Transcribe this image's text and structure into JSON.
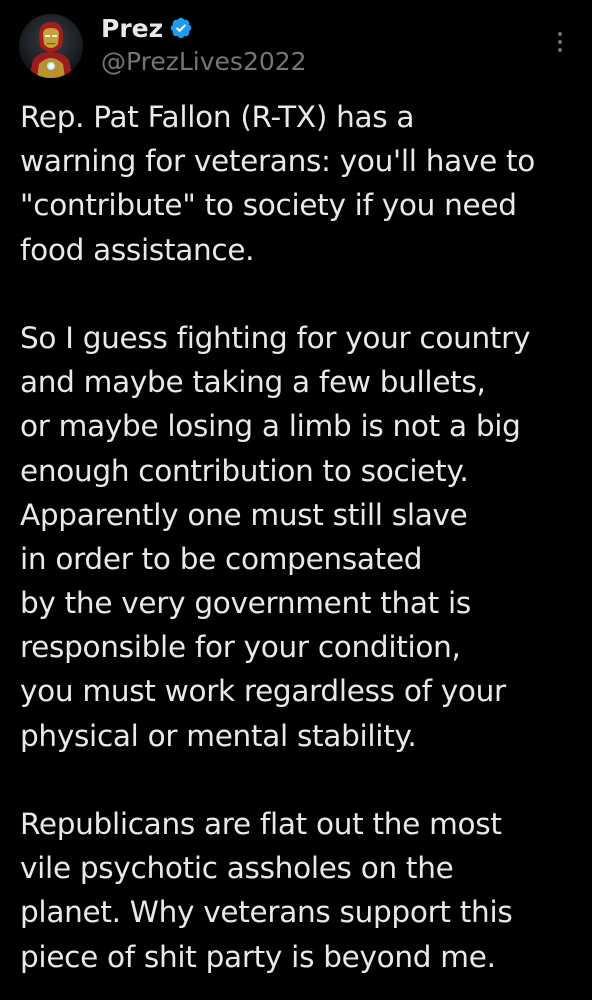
{
  "author": {
    "display_name": "Prez",
    "handle": "@PrezLives2022",
    "verified": true,
    "avatar_icon": "iron-man-avatar",
    "verified_color": "#1d9bf0"
  },
  "menu": {
    "more_icon": "more-options-icon"
  },
  "tweet": {
    "paragraphs": [
      {
        "lines": [
          "Rep. Pat Fallon (R-TX) has a",
          "warning for veterans: you'll have to",
          "\"contribute\" to society if you need",
          "food assistance."
        ]
      },
      {
        "lines": [
          "So I guess fighting for your country",
          "and maybe taking a few bullets,",
          "or maybe losing a limb is not a big",
          "enough contribution to society.",
          "Apparently one must still slave",
          "in order to be compensated",
          "by the very government that is",
          "responsible for your condition,",
          "you must work regardless of your",
          "physical or mental stability."
        ]
      },
      {
        "lines": [
          "Republicans are flat out the most",
          "vile psychotic assholes on the",
          "planet. Why veterans support this",
          "piece of shit party is beyond me."
        ]
      }
    ]
  },
  "colors": {
    "background": "#000000",
    "primary_text": "#e7e9ea",
    "secondary_text": "#71767b"
  }
}
